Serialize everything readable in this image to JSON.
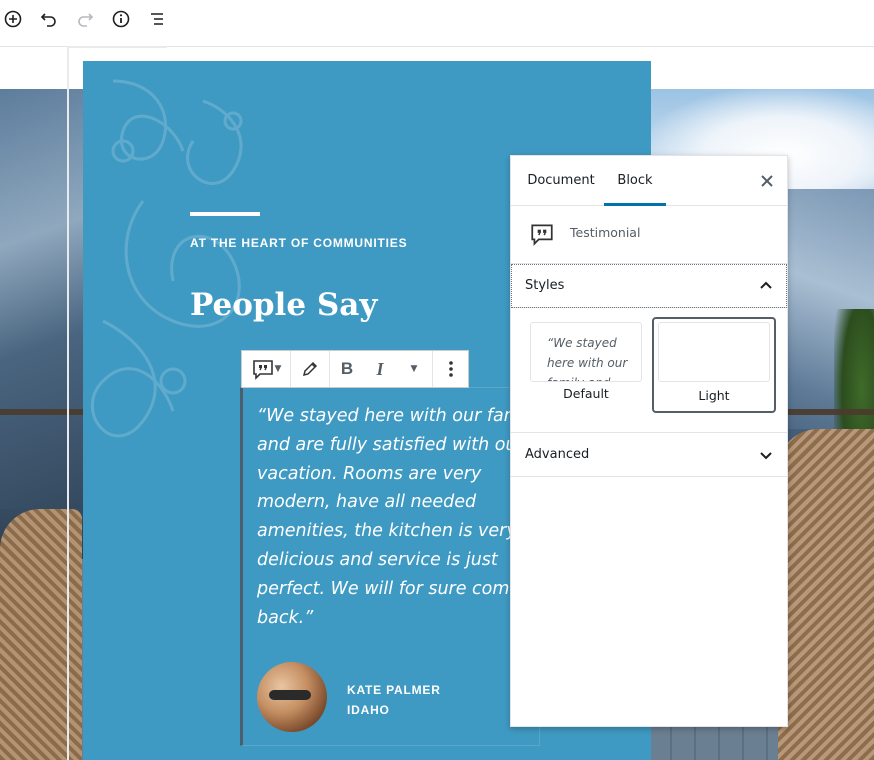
{
  "toolbar": {
    "add_block": "add-block",
    "undo": "undo",
    "redo": "redo",
    "info": "content-info",
    "outline": "block-navigation"
  },
  "section": {
    "eyebrow": "AT THE HEART OF COMMUNITIES",
    "heading": "People Say",
    "accent_color": "#3f9ac3"
  },
  "testimonial": {
    "quote_lines": [
      "“We stayed here with our family",
      "and are fully satisfied with our",
      "vacation. Rooms are very",
      "modern, have all needed",
      "amenities, the kitchen is very",
      "delicious and service is just",
      "perfect. We will for sure come",
      "back.”"
    ],
    "name": "KATE PALMER",
    "location": "IDAHO"
  },
  "block_toolbar": {
    "bold": "B",
    "italic": "I"
  },
  "sidebar": {
    "tabs": [
      {
        "label": "Document",
        "active": false
      },
      {
        "label": "Block",
        "active": true
      }
    ],
    "block_name": "Testimonial",
    "panels": {
      "styles": {
        "title": "Styles",
        "expanded": true,
        "options": [
          {
            "label": "Default",
            "preview": "“We stayed here with our family and",
            "selected": false
          },
          {
            "label": "Light",
            "preview": "",
            "selected": true
          }
        ]
      },
      "advanced": {
        "title": "Advanced",
        "expanded": false
      }
    },
    "tab_accent": "#0073aa"
  }
}
